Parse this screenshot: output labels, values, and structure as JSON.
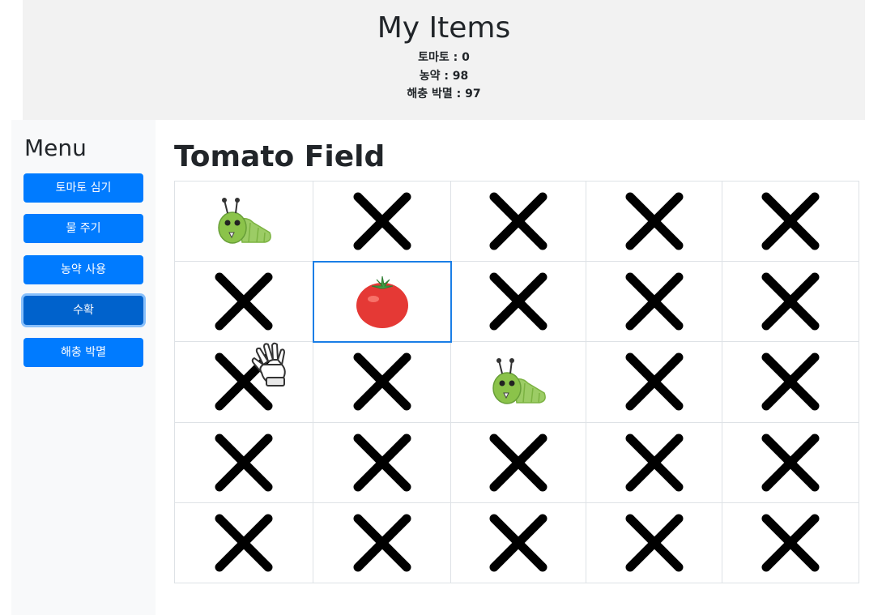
{
  "items": {
    "title": "My Items",
    "lines": [
      {
        "label": "토마토 : 0"
      },
      {
        "label": "농약 : 98"
      },
      {
        "label": "해충 박멸 : 97"
      }
    ]
  },
  "sidebar": {
    "title": "Menu",
    "buttons": [
      {
        "label": "토마토 심기"
      },
      {
        "label": "물 주기"
      },
      {
        "label": "농약 사용"
      },
      {
        "label": "수확"
      },
      {
        "label": "해충 박멸"
      }
    ],
    "active_button": "수확"
  },
  "field": {
    "title": "Tomato Field",
    "rows": [
      [
        "bug-icon",
        "x-icon",
        "x-icon",
        "x-icon",
        "x-icon"
      ],
      [
        "x-icon",
        "tomato-icon",
        "x-icon",
        "x-icon",
        "x-icon"
      ],
      [
        "x-icon",
        "x-icon",
        "bug-icon",
        "x-icon",
        "x-icon"
      ],
      [
        "x-icon",
        "x-icon",
        "x-icon",
        "x-icon",
        "x-icon"
      ],
      [
        "x-icon",
        "x-icon",
        "x-icon",
        "x-icon",
        "x-icon"
      ]
    ],
    "selected_cell": {
      "row": 2,
      "col": 1
    }
  },
  "cursor": {
    "icon": "glove-cursor-icon"
  },
  "colors": {
    "button": "#007bff",
    "button_active": "#0062cc",
    "bug": "#8bc34a",
    "tomato": "#e53935",
    "selection": "#1a7ee6"
  }
}
